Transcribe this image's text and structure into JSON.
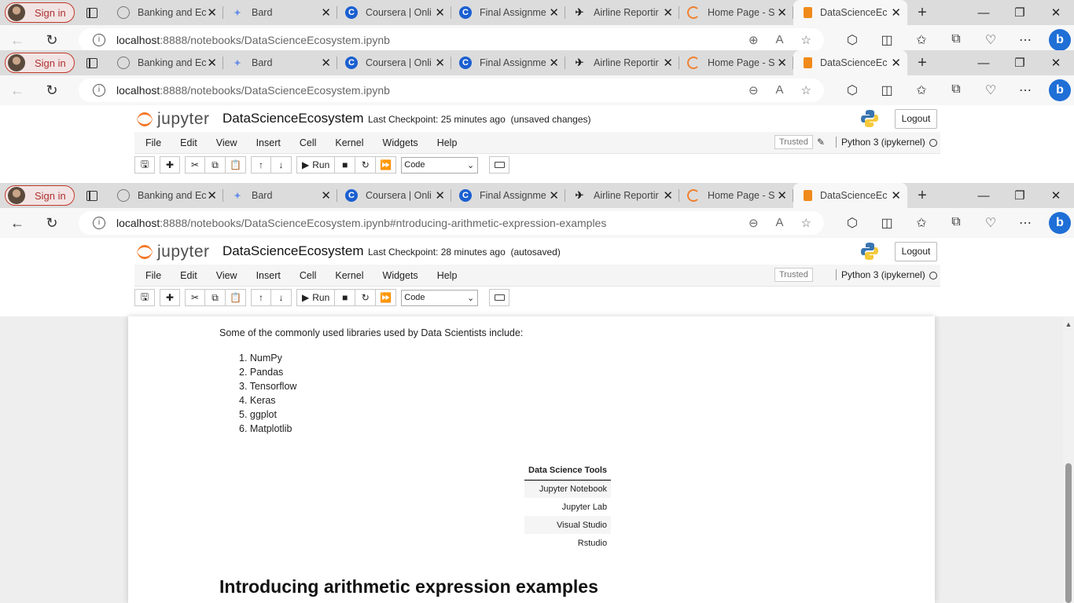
{
  "browser": {
    "signin_label": "Sign in",
    "tabs": [
      {
        "title": "Banking and Ec",
        "icon": "chatgpt-icon"
      },
      {
        "title": "Bard",
        "icon": "bard-sparkle-icon"
      },
      {
        "title": "Coursera | Onli",
        "icon": "coursera-icon"
      },
      {
        "title": "Final Assignme",
        "icon": "coursera-icon"
      },
      {
        "title": "Airline Reportir",
        "icon": "github-icon"
      },
      {
        "title": "Home Page - S",
        "icon": "loading-spinner-icon"
      },
      {
        "title": "DataScienceEc",
        "icon": "notebook-icon"
      }
    ],
    "url_host_1": "localhost",
    "url_path_1": ":8888/notebooks/DataScienceEcosystem.ipynb",
    "url_host_2": "localhost",
    "url_path_2": ":8888/notebooks/DataScienceEcosystem.ipynb",
    "url_host_3": "localhost",
    "url_path_3": ":8888/notebooks/DataScienceEcosystem.ipynb#ntroducing-arithmetic-expression-examples"
  },
  "jupyter": {
    "logo_text": "jupyter",
    "notebook_name": "DataScienceEcosystem",
    "checkpoint_1": "Last Checkpoint: 25 minutes ago",
    "status_1": "(unsaved changes)",
    "checkpoint_2": "Last Checkpoint: 28 minutes ago",
    "status_2": "(autosaved)",
    "logout_label": "Logout",
    "menu": [
      "File",
      "Edit",
      "View",
      "Insert",
      "Cell",
      "Kernel",
      "Widgets",
      "Help"
    ],
    "trusted_label": "Trusted",
    "kernel_label": "Python 3 (ipykernel)",
    "run_label": "Run",
    "cell_type": "Code"
  },
  "notebook": {
    "intro": "Some of the commonly used libraries used by Data Scientists include:",
    "libraries": [
      "1. NumPy",
      "2. Pandas",
      "3. Tensorflow",
      "4. Keras",
      "5. ggplot",
      "6. Matplotlib"
    ],
    "tools_header": "Data Science Tools",
    "tools": [
      "Jupyter Notebook",
      "Jupyter Lab",
      "Visual Studio",
      "Rstudio"
    ],
    "heading": "Introducing arithmetic expression examples"
  }
}
